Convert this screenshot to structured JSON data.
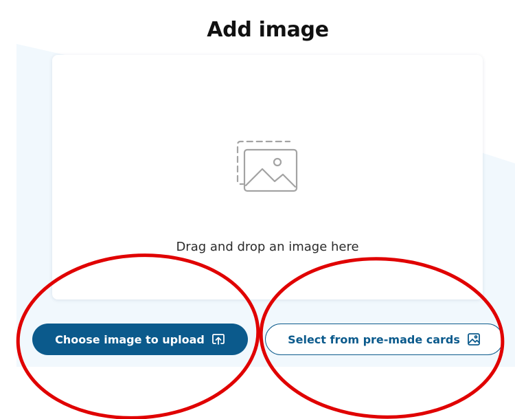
{
  "header": {
    "title": "Add image"
  },
  "dropzone": {
    "instruction": "Drag and drop an image here",
    "icon": "image-placeholder-icon"
  },
  "actions": {
    "upload_label": "Choose image to upload",
    "upload_icon": "upload-icon",
    "premade_label": "Select from pre-made cards",
    "premade_icon": "image-icon"
  },
  "colors": {
    "primary": "#0b5a8c",
    "panel_background": "#f1f8fd",
    "annotation_red": "#e00000"
  }
}
